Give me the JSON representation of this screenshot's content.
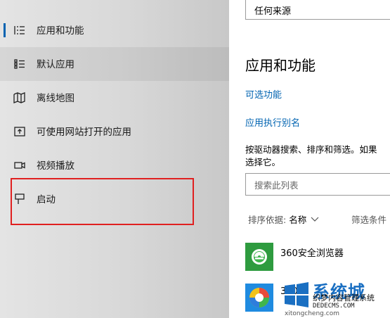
{
  "sidebar": {
    "items": [
      {
        "label": "应用和功能",
        "icon": "apps-features-icon"
      },
      {
        "label": "默认应用",
        "icon": "default-apps-icon"
      },
      {
        "label": "离线地图",
        "icon": "offline-maps-icon"
      },
      {
        "label": "可使用网站打开的应用",
        "icon": "apps-for-websites-icon"
      },
      {
        "label": "视频播放",
        "icon": "video-playback-icon"
      },
      {
        "label": "启动",
        "icon": "startup-icon"
      }
    ]
  },
  "main": {
    "source_select_value": "任何来源",
    "heading": "应用和功能",
    "optional_features_link": "可选功能",
    "app_alias_link": "应用执行别名",
    "description": "按驱动器搜索、排序和筛选。如果\n选择它。",
    "search_placeholder": "搜索此列表",
    "sort_label": "排序依据:",
    "sort_value": "名称",
    "filter_label": "筛选条件",
    "apps": [
      {
        "name": "360安全浏览器"
      },
      {
        "name": "360"
      }
    ]
  },
  "watermark": {
    "big": "系统城",
    "mid": "织梦内容管理系统",
    "small": "DEDECMS.COM",
    "bottom": "xitongcheng.com"
  },
  "colors": {
    "accent": "#0063b1",
    "highlight_border": "#e02020",
    "app_360_green": "#2e9b3f"
  }
}
